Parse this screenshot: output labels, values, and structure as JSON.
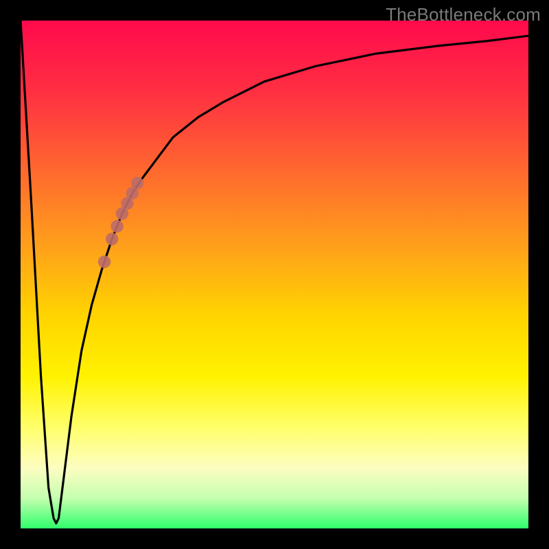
{
  "watermark": "TheBottleneck.com",
  "colors": {
    "curve": "#000000",
    "marker": "#be6b68",
    "frame": "#000000"
  },
  "chart_data": {
    "type": "line",
    "title": "",
    "xlabel": "",
    "ylabel": "",
    "xlim": [
      0,
      100
    ],
    "ylim": [
      0,
      100
    ],
    "grid": false,
    "legend": false,
    "series": [
      {
        "name": "bottleneck-curve",
        "x": [
          0,
          2,
          4,
          5.5,
          6.5,
          7,
          7.5,
          8.5,
          10,
          12,
          14,
          16,
          18,
          20,
          22,
          24,
          27,
          30,
          35,
          40,
          48,
          58,
          70,
          82,
          92,
          100
        ],
        "y": [
          100,
          66,
          30,
          8,
          2,
          1,
          2,
          10,
          22,
          35,
          44,
          51,
          57,
          62,
          66,
          69,
          73,
          77,
          81,
          84,
          88,
          91,
          93.5,
          95,
          96,
          97
        ]
      }
    ],
    "markers": [
      {
        "name": "highlight-segment",
        "points": [
          {
            "x": 18,
            "y": 57
          },
          {
            "x": 19,
            "y": 59.5
          },
          {
            "x": 20,
            "y": 62
          },
          {
            "x": 21,
            "y": 64
          },
          {
            "x": 22,
            "y": 66
          },
          {
            "x": 23,
            "y": 68
          }
        ]
      },
      {
        "name": "isolated-dot",
        "points": [
          {
            "x": 16.5,
            "y": 52.5
          }
        ]
      }
    ]
  }
}
